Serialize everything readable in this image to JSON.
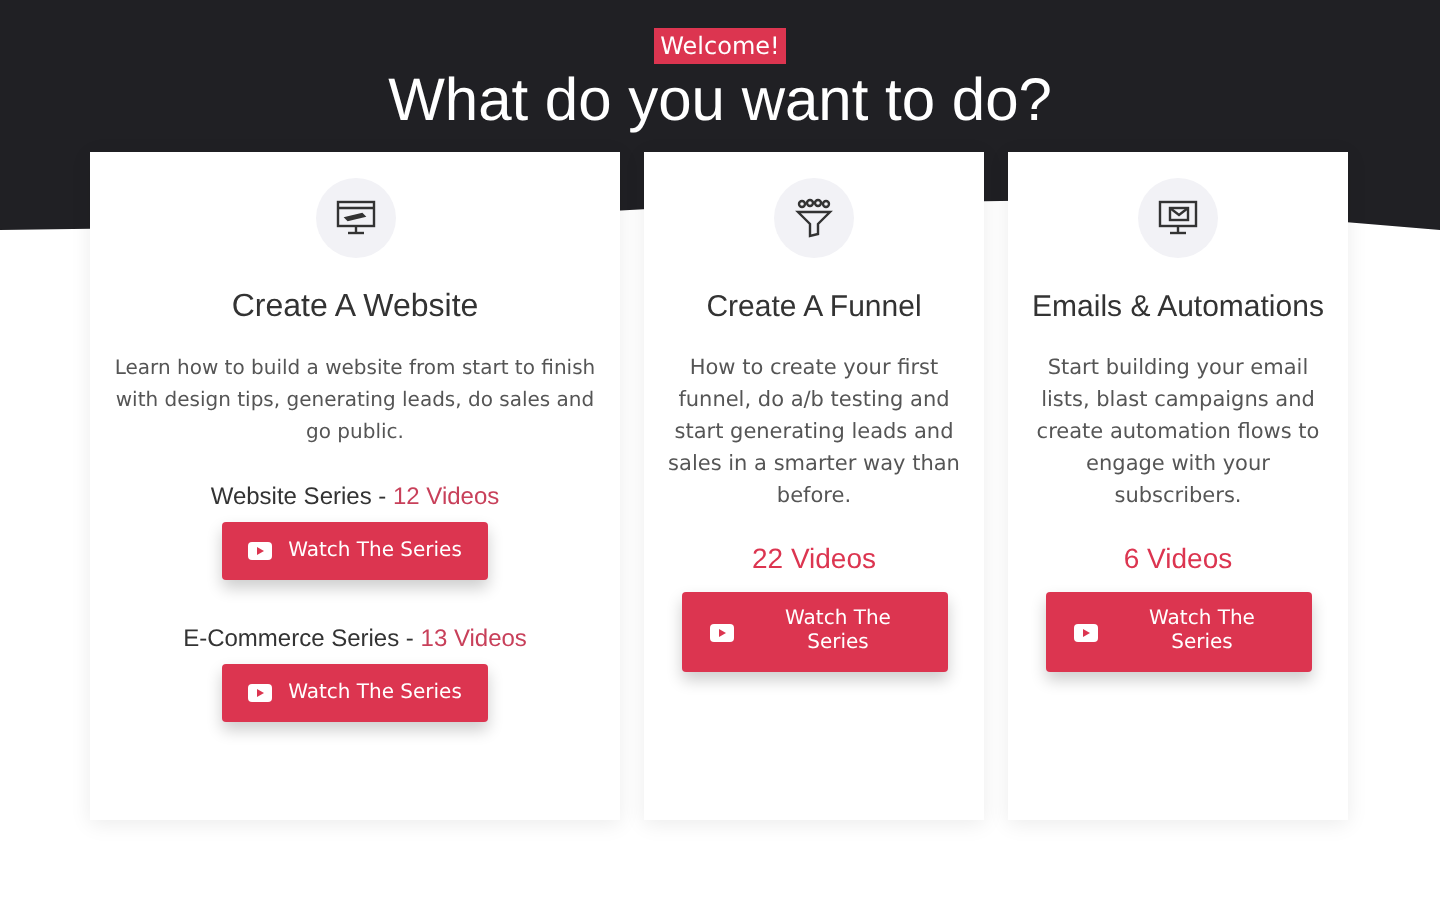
{
  "badge": "Welcome!",
  "heading": "What do you want to do?",
  "cards": [
    {
      "kind": "series",
      "title": "Create A Website",
      "description": "Learn how to build a website from start to finish with design tips, generating leads, do sales and go public.",
      "series": [
        {
          "label": "Website Series - ",
          "count": "12 Videos",
          "button": "Watch The Series"
        },
        {
          "label": "E-Commerce Series - ",
          "count": "13 Videos",
          "button": "Watch The Series"
        }
      ]
    },
    {
      "kind": "single",
      "title": "Create A Funnel",
      "description": "How to create your first funnel, do a/b testing and start generating leads and sales in a smarter way than before.",
      "count": "22 Videos",
      "button": "Watch The Series"
    },
    {
      "kind": "single",
      "title": "Emails & Automations",
      "description": "Start building your email lists, blast campaigns and create automation flows to engage with your subscribers.",
      "count": "6 Videos",
      "button": "Watch The Series"
    }
  ]
}
